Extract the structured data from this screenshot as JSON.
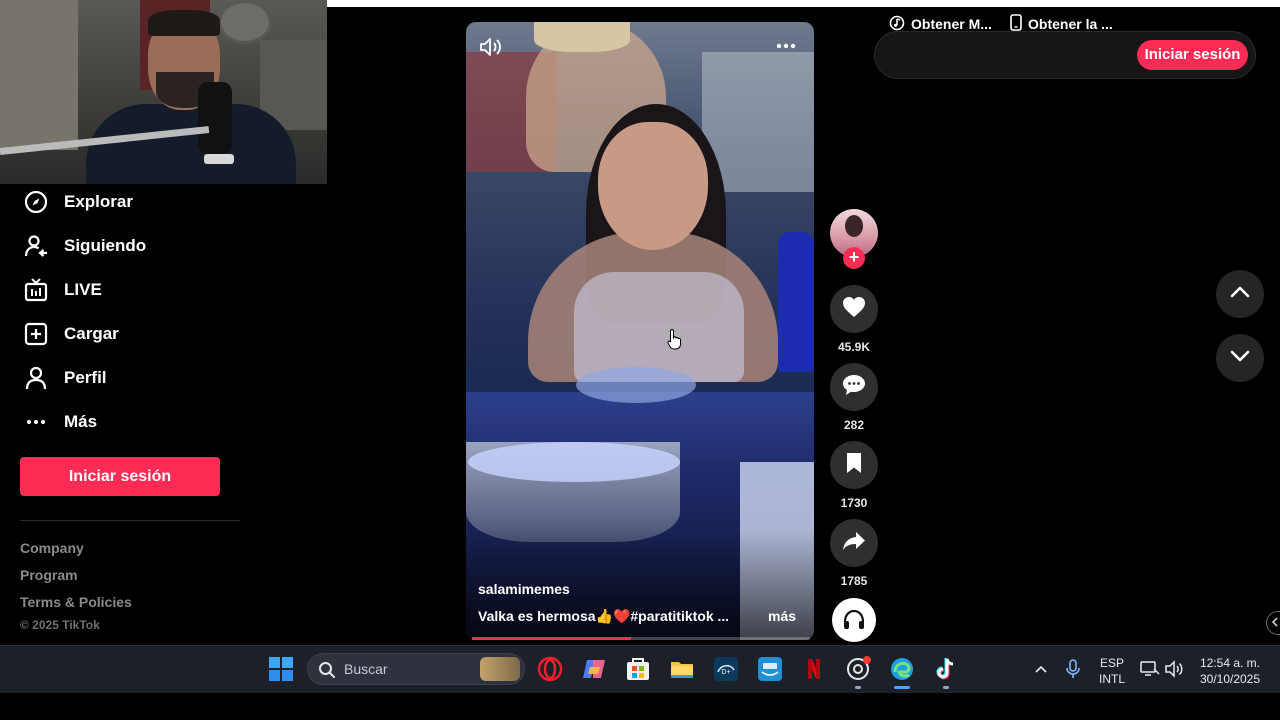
{
  "sidebar": {
    "items": [
      {
        "label": "Explorar",
        "icon": "compass-icon"
      },
      {
        "label": "Siguiendo",
        "icon": "user-following-icon"
      },
      {
        "label": "LIVE",
        "icon": "live-tv-icon"
      },
      {
        "label": "Cargar",
        "icon": "upload-plus-icon"
      },
      {
        "label": "Perfil",
        "icon": "profile-icon"
      },
      {
        "label": "Más",
        "icon": "more-dots-icon"
      }
    ],
    "login_label": "Iniciar sesión",
    "footer_links": [
      "Company",
      "Program",
      "Terms & Policies"
    ],
    "copyright": "© 2025 TikTok"
  },
  "video": {
    "author": "salamimemes",
    "caption": "Valka es hermosa👍❤️#paratitiktok ...",
    "more_label": "más",
    "progress": 0.47
  },
  "actions": {
    "likes": "45.9K",
    "comments": "282",
    "saves": "1730",
    "shares": "1785"
  },
  "top_bar": {
    "get_music_label": "Obtener M...",
    "get_app_label": "Obtener la ...",
    "login_label": "Iniciar sesión"
  },
  "taskbar": {
    "search_label": "Buscar",
    "lang_line1": "ESP",
    "lang_line2": "INTL",
    "time": "12:54 a. m.",
    "date": "30/10/2025"
  },
  "colors": {
    "accent": "#fe2c55",
    "background": "#000000",
    "taskbar": "#1c2029"
  }
}
